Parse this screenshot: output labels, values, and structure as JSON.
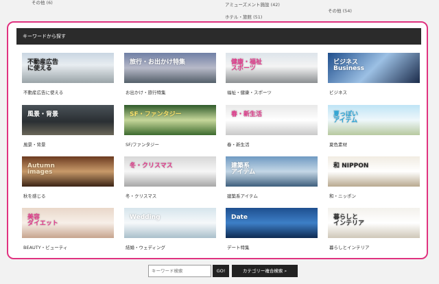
{
  "top_links": {
    "left": "その他 (6)",
    "middle1": "アミューズメント施設 (42)",
    "middle2": "ホテル・旅館 (51)",
    "right": "その他 (54)"
  },
  "panel": {
    "heading": "キーワードから探す"
  },
  "cards": [
    {
      "caption": "不動産広告に使える",
      "thumb_text": "不動産広告\nに使える",
      "bg": "linear-gradient(180deg,#c9d6e2 0%,#e8edf1 40%,#9aa4a8 100%)",
      "fg": "#222"
    },
    {
      "caption": "お出かけ・旅行特集",
      "thumb_text": "旅行・お出かけ特集",
      "bg": "linear-gradient(180deg,#6f7fa5 0%,#b7b9c8 50%,#54606a 100%)",
      "fg": "#ffffff"
    },
    {
      "caption": "福祉・健康・スポーツ",
      "thumb_text": "健康・福祉\nスポーツ",
      "bg": "linear-gradient(180deg,#dde4ea 0%,#f4f4f4 45%,#8b8f92 100%)",
      "fg": "#e23b8c"
    },
    {
      "caption": "ビジネス",
      "thumb_text": "ビジネス\nBusiness",
      "bg": "linear-gradient(135deg,#1f4e8c 0%,#9cc0e4 50%,#1b2b4a 100%)",
      "fg": "#ffffff"
    },
    {
      "caption": "風景・背景",
      "thumb_text": "風景・背景",
      "bg": "linear-gradient(180deg,#4a5258 0%,#2a2f33 55%,#6a6658 100%)",
      "fg": "#ffffff"
    },
    {
      "caption": "SF/ファンタジー",
      "thumb_text": "SF・ファンタジー",
      "bg": "linear-gradient(180deg,#2f5a2a 0%,#c6d79a 50%,#3d6b2f 100%)",
      "fg": "#f6e06a"
    },
    {
      "caption": "春・新生活",
      "thumb_text": "春・新生活",
      "bg": "linear-gradient(180deg,#e8e8e8 0%,#ffffff 50%,#c9c9c9 100%)",
      "fg": "#e23b8c"
    },
    {
      "caption": "夏色素材",
      "thumb_text": "夏っぽい\nアイテム",
      "bg": "linear-gradient(180deg,#bfe4f5 0%,#eef7fb 50%,#b7c9a0 100%)",
      "fg": "#2aa6d8"
    },
    {
      "caption": "秋を感じる",
      "thumb_text": "Autumn\nimages",
      "bg": "linear-gradient(180deg,#6b3a20 0%,#c89a6a 50%,#3b2415 100%)",
      "fg": "#f3e0c0"
    },
    {
      "caption": "冬・クリスマス",
      "thumb_text": "冬・クリスマス",
      "bg": "linear-gradient(180deg,#d7d7d7 0%,#f6f6f6 50%,#a7a7a7 100%)",
      "fg": "#e23b8c"
    },
    {
      "caption": "建築系アイテム",
      "thumb_text": "建築系\nアイテム",
      "bg": "linear-gradient(180deg,#6f9ac2 0%,#c4d7e6 50%,#3f5f7d 100%)",
      "fg": "#ffffff"
    },
    {
      "caption": "和・ニッポン",
      "thumb_text": "和 NIPPON",
      "bg": "linear-gradient(180deg,#f1ece2 0%,#ffffff 50%,#b8a98f 100%)",
      "fg": "#222"
    },
    {
      "caption": "BEAUTY・ビューティ",
      "thumb_text": "美容\nダイエット",
      "bg": "linear-gradient(180deg,#e9d7c9 0%,#f7efe8 50%,#c7a48e 100%)",
      "fg": "#e23b8c"
    },
    {
      "caption": "結婚・ウェディング",
      "thumb_text": "Wedding",
      "bg": "linear-gradient(180deg,#d6e5ec 0%,#f5f8fa 50%,#a9bfcb 100%)",
      "fg": "#ffffff"
    },
    {
      "caption": "デート特集",
      "thumb_text": "Date",
      "bg": "linear-gradient(180deg,#1e4f8f 0%,#3d7fc7 50%,#0e2a52 100%)",
      "fg": "#ffffff"
    },
    {
      "caption": "暮らしとインテリア",
      "thumb_text": "暮らしと\nインテリア",
      "bg": "linear-gradient(180deg,#f3f1ec 0%,#ffffff 50%,#cfc7b8 100%)",
      "fg": "#333"
    }
  ],
  "search": {
    "placeholder": "キーワード検索",
    "go_label": "GO!",
    "category_label": "カテゴリー複合検索",
    "search_icon": "search-icon"
  },
  "colors": {
    "accent": "#e0317f",
    "heading_bg": "#2b2b2b"
  }
}
